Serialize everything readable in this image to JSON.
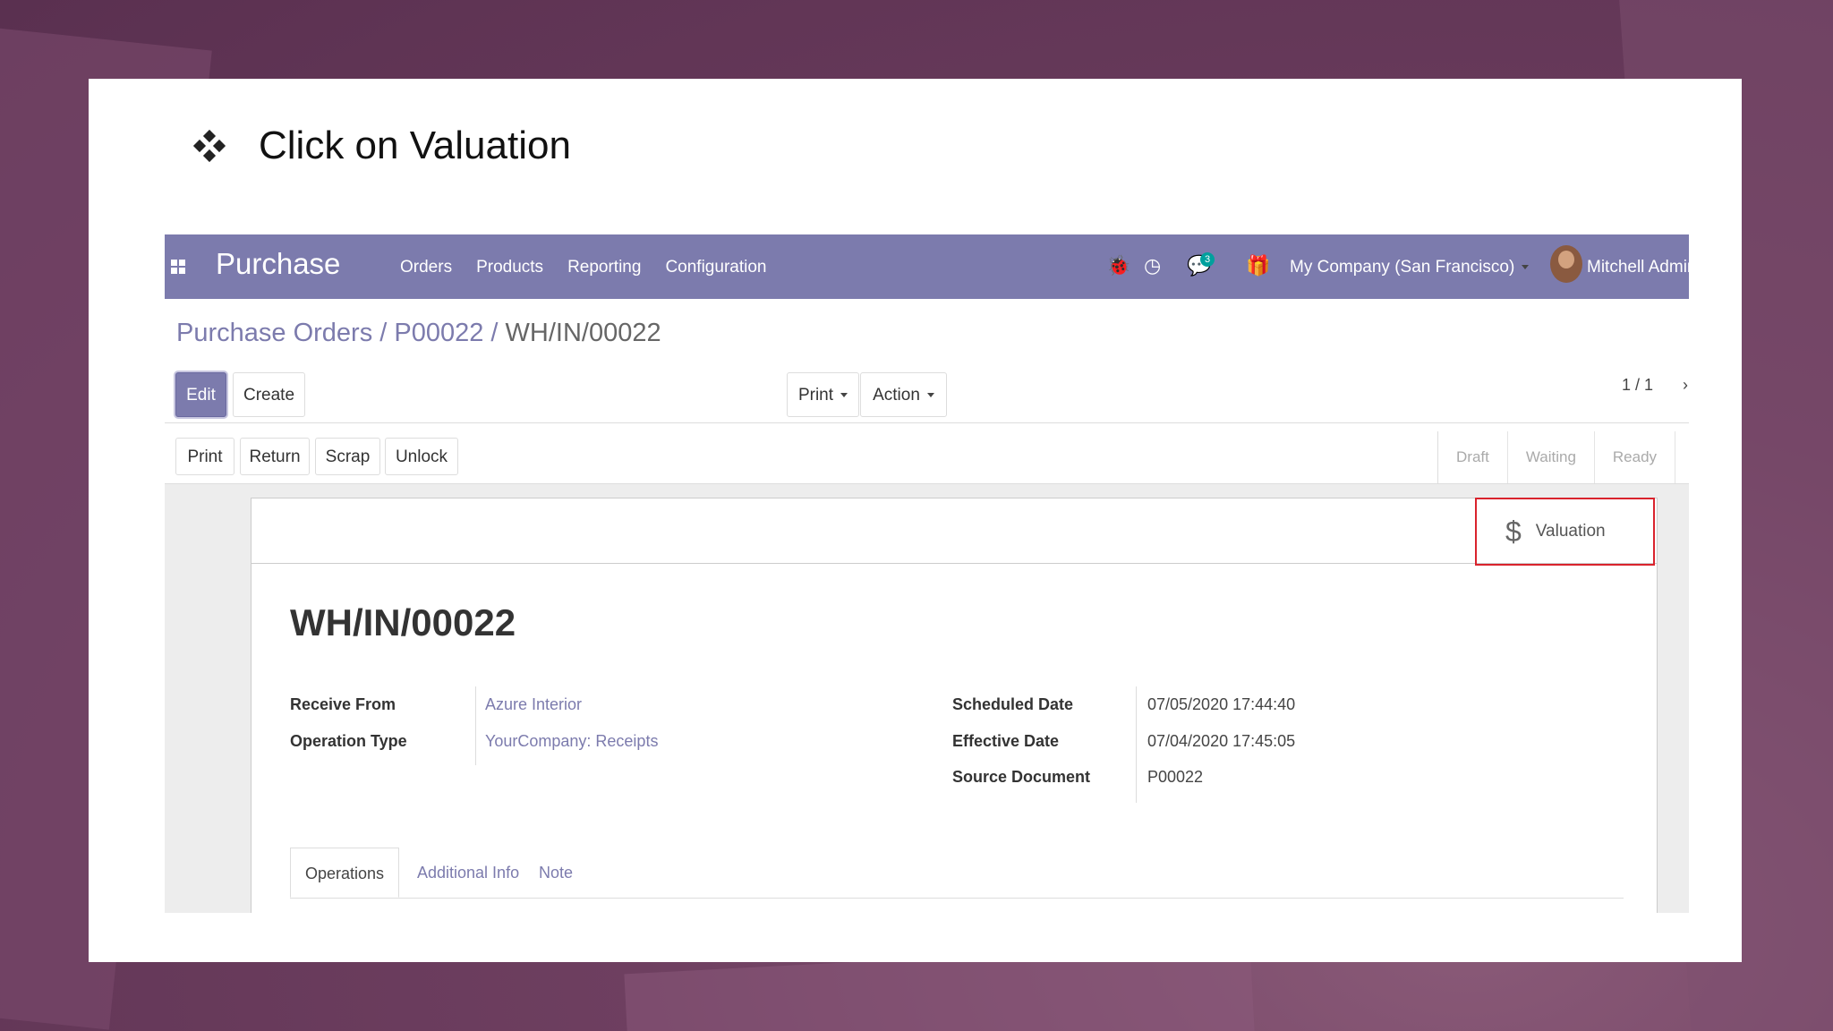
{
  "slide": {
    "instruction": "Click on Valuation",
    "bullet_icon": "diamond-cluster-icon"
  },
  "app": {
    "brand": "Purchase",
    "menu": [
      "Orders",
      "Products",
      "Reporting",
      "Configuration"
    ],
    "chat_badge": "3",
    "company": "My Company (San Francisco)",
    "user": "Mitchell Admir"
  },
  "breadcrumb": {
    "part1": "Purchase Orders",
    "sep": " / ",
    "part2": "P00022",
    "current": "WH/IN/00022"
  },
  "toolbar": {
    "edit": "Edit",
    "create": "Create",
    "print": "Print",
    "action": "Action",
    "pager": "1 / 1"
  },
  "statusbar": {
    "buttons": [
      "Print",
      "Return",
      "Scrap",
      "Unlock"
    ],
    "stages": [
      "Draft",
      "Waiting",
      "Ready"
    ]
  },
  "form": {
    "valuation_label": "Valuation",
    "title": "WH/IN/00022",
    "receive_from_label": "Receive From",
    "receive_from_value": "Azure Interior",
    "operation_type_label": "Operation Type",
    "operation_type_value": "YourCompany: Receipts",
    "scheduled_date_label": "Scheduled Date",
    "scheduled_date_value": "07/05/2020 17:44:40",
    "effective_date_label": "Effective Date",
    "effective_date_value": "07/04/2020 17:45:05",
    "source_document_label": "Source Document",
    "source_document_value": "P00022",
    "tabs": [
      "Operations",
      "Additional Info",
      "Note"
    ]
  },
  "colors": {
    "navbar": "#7c7bad",
    "highlight": "#d9232d",
    "background": "#6e3f60"
  }
}
